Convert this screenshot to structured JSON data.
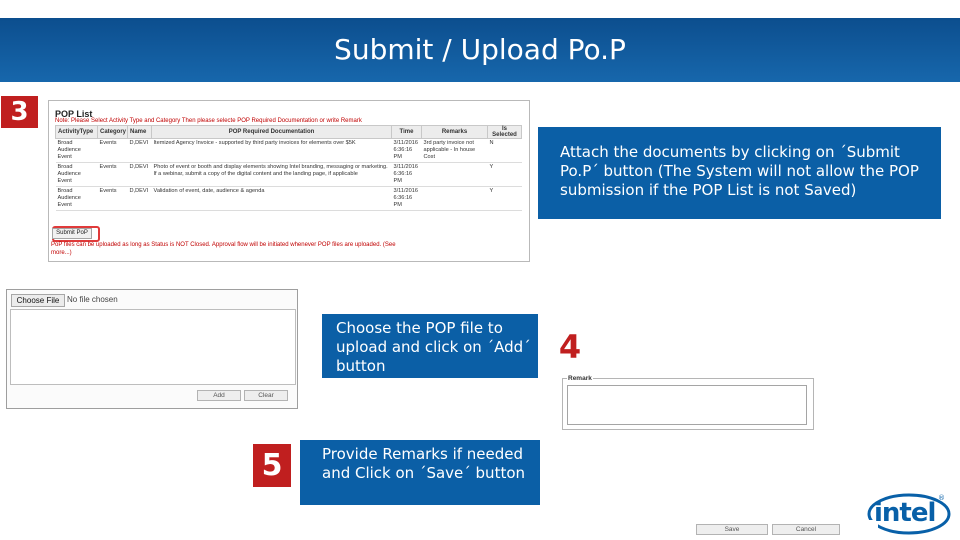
{
  "title": "Submit / Upload Po.P",
  "steps": {
    "step3": "3",
    "step4": "4",
    "step5": "5"
  },
  "callouts": {
    "attach": "Attach the documents by clicking on ´Submit Po.P´ button (The System will not allow the POP submission if the POP List is not Saved)",
    "choose": "Choose the POP file to upload and click on ´Add´ button",
    "remarks": "Provide Remarks if needed and Click on ´Save´ button"
  },
  "pop_list": {
    "title": "POP List",
    "note": "Note: Please Select Activity Type and Category Then please selecte POP Required Documentation or write Remark",
    "columns": [
      "ActivityType",
      "Category",
      "Name",
      "POP Required Documentation",
      "Time",
      "Remarks",
      "Is Selected"
    ],
    "rows": [
      {
        "activity_type": "Broad Audience Event",
        "category": "Events",
        "name": "D,DEVI",
        "doc": "Itemized Agency Invoice - supported by third party invoices for elements over $5K",
        "time": "3/11/2016 6:36:16 PM",
        "remarks": "3rd party invoice not applicable - In house Cost",
        "selected": "N"
      },
      {
        "activity_type": "Broad Audience Event",
        "category": "Events",
        "name": "D,DEVI",
        "doc": "Photo of event or booth and display elements showing Intel branding, messaging or marketing. If a webinar, submit a copy of the digital content and the landing page, if applicable",
        "time": "3/11/2016 6:36:16 PM",
        "remarks": "",
        "selected": "Y"
      },
      {
        "activity_type": "Broad Audience Event",
        "category": "Events",
        "name": "D,DEVI",
        "doc": "Validation of event, date, audience & agenda",
        "time": "3/11/2016 6:36:16 PM",
        "remarks": "",
        "selected": "Y"
      }
    ],
    "submit_label": "Submit PoP",
    "footer": "PoP files can be uploaded as long as Status is NOT Closed. Approval flow will be initiated whenever POP files are uploaded. (See more...)"
  },
  "upload": {
    "choose_label": "Choose File",
    "no_file": "No file chosen",
    "add_label": "Add",
    "clear_label": "Clear"
  },
  "remark": {
    "label": "Remark",
    "save_label": "Save",
    "cancel_label": "Cancel"
  },
  "logo": {
    "text": "intel",
    "mark": "®"
  },
  "colors": {
    "header_blue": "#1767ac",
    "callout_blue": "#0b5fa6",
    "step_red": "#c01f1f",
    "intel_blue": "#0860a8"
  }
}
